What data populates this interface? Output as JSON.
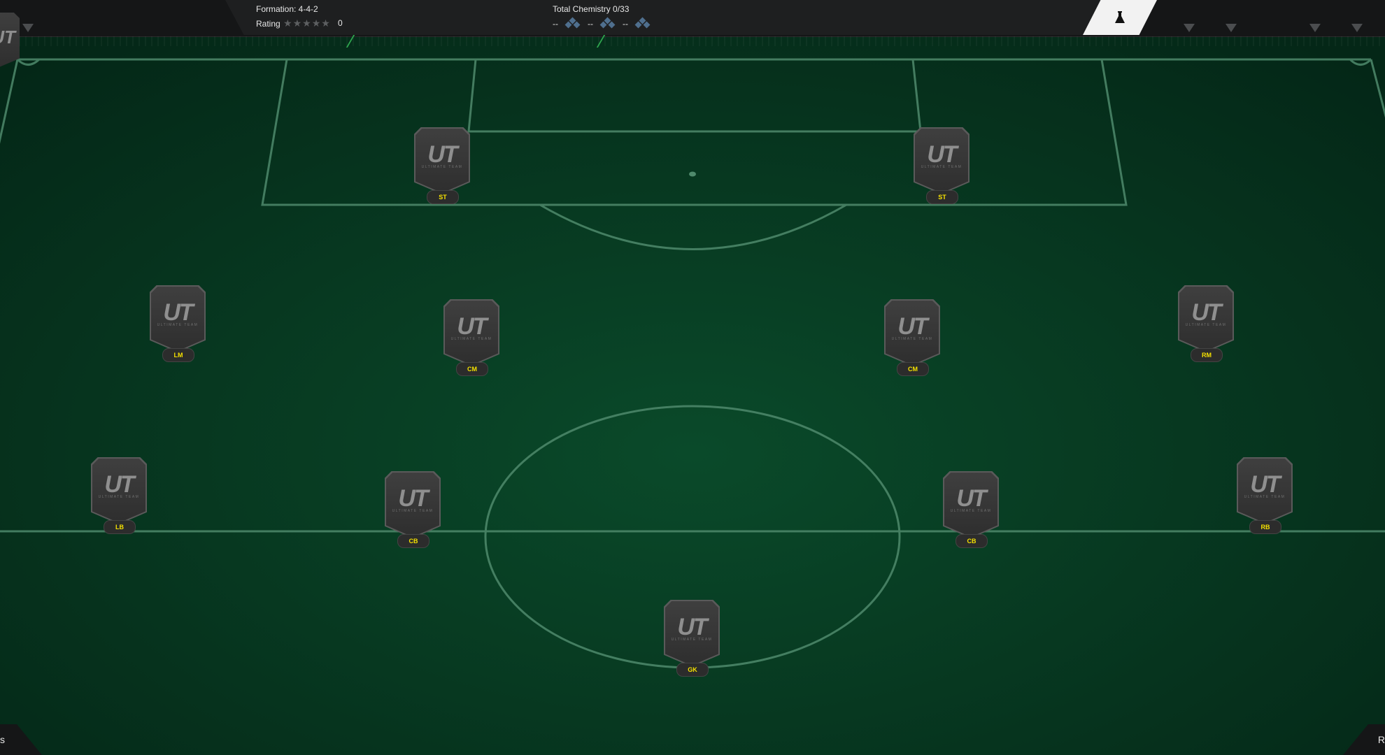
{
  "header": {
    "formation_label": "Formation: 4-4-2",
    "rating_label": "Rating",
    "rating_stars": 0,
    "rating_value": "0",
    "chemistry_label": "Total Chemistry 0/33",
    "chemistry_slots": [
      "--",
      "--",
      "--"
    ]
  },
  "pitch": {
    "card_logo": "UT",
    "card_subtitle": "ULTIMATE TEAM",
    "players": [
      {
        "position": "ST"
      },
      {
        "position": "ST"
      },
      {
        "position": "LM"
      },
      {
        "position": "CM"
      },
      {
        "position": "CM"
      },
      {
        "position": "RM"
      },
      {
        "position": "LB"
      },
      {
        "position": "CB"
      },
      {
        "position": "CB"
      },
      {
        "position": "RB"
      },
      {
        "position": "GK"
      }
    ]
  },
  "footer": {
    "left_label": "s",
    "right_label": "R"
  },
  "colors": {
    "pitch": "#06301c",
    "position_text": "#f5e100",
    "chemistry_icon": "#4f6f8e"
  },
  "icons": {
    "lab": "flask-icon",
    "chemistry": "chemistry-diamond-icon",
    "dropdown": "triangle-down-icon"
  }
}
